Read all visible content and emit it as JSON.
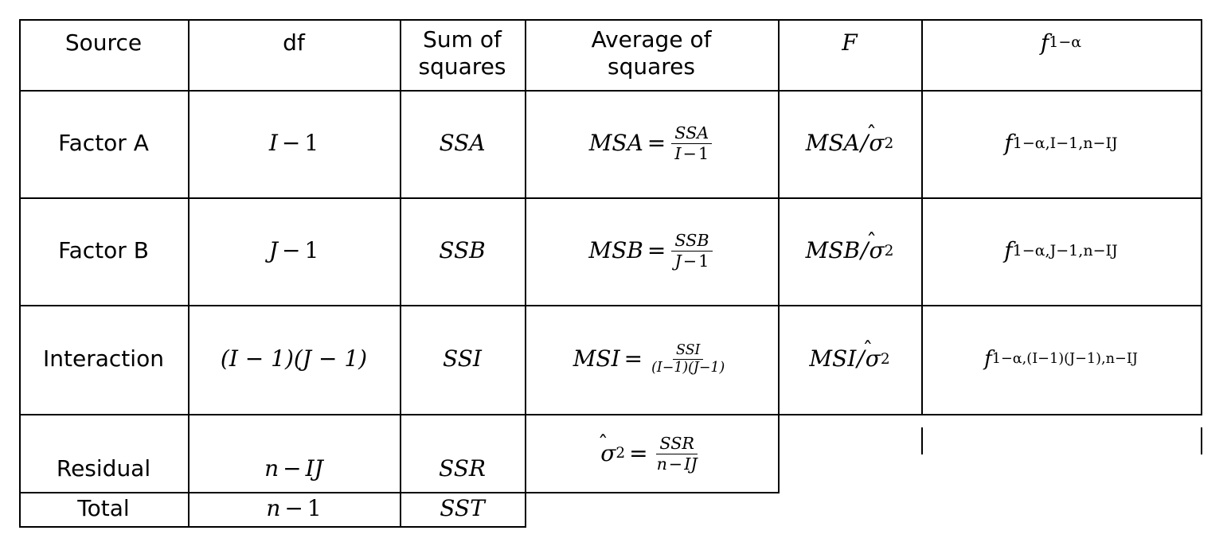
{
  "table": {
    "name": "two-way-anova-table",
    "columns": [
      {
        "key": "source",
        "label": "Source"
      },
      {
        "key": "df",
        "label": "df"
      },
      {
        "key": "ss",
        "label_line1": "Sum of",
        "label_line2": "squares"
      },
      {
        "key": "ms",
        "label_line1": "Average of",
        "label_line2": "squares"
      },
      {
        "key": "f",
        "label": "F"
      },
      {
        "key": "fcrit",
        "label": "f",
        "label_sub": "1−α"
      }
    ],
    "rows": [
      {
        "source": "Factor A",
        "df_left": "I",
        "df_op": "−",
        "df_right": "1",
        "ss": "SSA",
        "ms_lhs": "MSA",
        "ms_eq": "=",
        "ms_num": "SSA",
        "ms_den_left": "I",
        "ms_den_op": "−",
        "ms_den_right": "1",
        "f_num": "MSA",
        "f_slash": "/",
        "f_sigma": "σ",
        "f_hat": "̂",
        "f_pow": "2",
        "fcrit_base": "f",
        "fcrit_sub": "1−α,I−1,n−IJ"
      },
      {
        "source": "Factor B",
        "df_left": "J",
        "df_op": "−",
        "df_right": "1",
        "ss": "SSB",
        "ms_lhs": "MSB",
        "ms_eq": "=",
        "ms_num": "SSB",
        "ms_den_left": "J",
        "ms_den_op": "−",
        "ms_den_right": "1",
        "f_num": "MSB",
        "f_slash": "/",
        "f_sigma": "σ",
        "f_hat": "̂",
        "f_pow": "2",
        "fcrit_base": "f",
        "fcrit_sub": "1−α,J−1,n−IJ"
      },
      {
        "source": "Interaction",
        "df_text": "(I − 1)(J − 1)",
        "ss": "SSI",
        "ms_lhs": "MSI",
        "ms_eq": "=",
        "ms_num": "SSI",
        "ms_den_text": "(I−1)(J−1)",
        "f_num": "MSI",
        "f_slash": "/",
        "f_sigma": "σ",
        "f_hat": "̂",
        "f_pow": "2",
        "fcrit_base": "f",
        "fcrit_sub": "1−α,(I−1)(J−1),n−IJ"
      },
      {
        "source": "Residual",
        "df_left": "n",
        "df_op": "−",
        "df_right": "IJ",
        "ss": "SSR",
        "ms_lhs_sigma": "σ",
        "ms_lhs_hat": "̂",
        "ms_lhs_pow": "2",
        "ms_eq": "=",
        "ms_num": "SSR",
        "ms_den_left": "n",
        "ms_den_op": "−",
        "ms_den_right": "IJ",
        "f_num": "",
        "fcrit_sub": ""
      },
      {
        "source": "Total",
        "df_left": "n",
        "df_op": "−",
        "df_right": "1",
        "ss": "SST",
        "f_num": "",
        "fcrit_sub": ""
      }
    ]
  },
  "style": {
    "rule_color": "#000000",
    "text_color": "#000000",
    "background": "#ffffff"
  }
}
